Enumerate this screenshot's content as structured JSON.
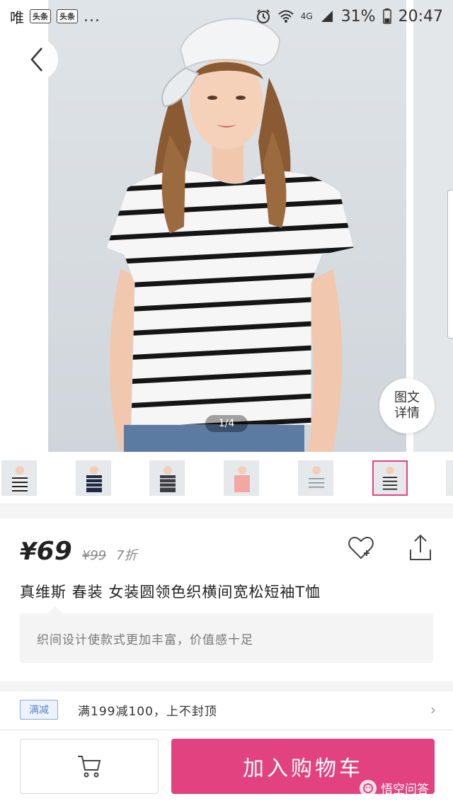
{
  "status_bar": {
    "carrier": "唯",
    "app_badges": [
      "头条",
      "头条"
    ],
    "more": "...",
    "network": "4G",
    "battery": "31%",
    "time": "20:47"
  },
  "hero": {
    "page_indicator": "1/4",
    "detail_button": {
      "line1": "图文",
      "line2": "详情"
    }
  },
  "thumbnails": [
    {
      "color": "#f0f0f0",
      "stripe": "#222",
      "active": false
    },
    {
      "color": "#1d2a44",
      "stripe": "#fff",
      "active": false
    },
    {
      "color": "#3b3f45",
      "stripe": "#ddd",
      "active": false
    },
    {
      "color": "#f2a7a3",
      "stripe": "#f2a7a3",
      "active": false
    },
    {
      "color": "#e8e8e8",
      "stripe": "#7a8aa0",
      "active": false
    },
    {
      "color": "#f0f0f0",
      "stripe": "#222",
      "active": true
    }
  ],
  "product": {
    "price_symbol": "¥",
    "price": "69",
    "original_price": "¥99",
    "discount": "7折",
    "title": "真维斯 春装 女装圆领色织横间宽松短袖T恤",
    "description": "织间设计使款式更加丰富，价值感十足"
  },
  "promo": {
    "tag": "满减",
    "text": "满199减100，上不封顶",
    "arrow": "›"
  },
  "bottom_bar": {
    "add_to_cart": "加入购物车"
  },
  "watermark": "悟空问答",
  "colors": {
    "accent": "#e2427f",
    "promo_blue": "#5a84c9"
  }
}
